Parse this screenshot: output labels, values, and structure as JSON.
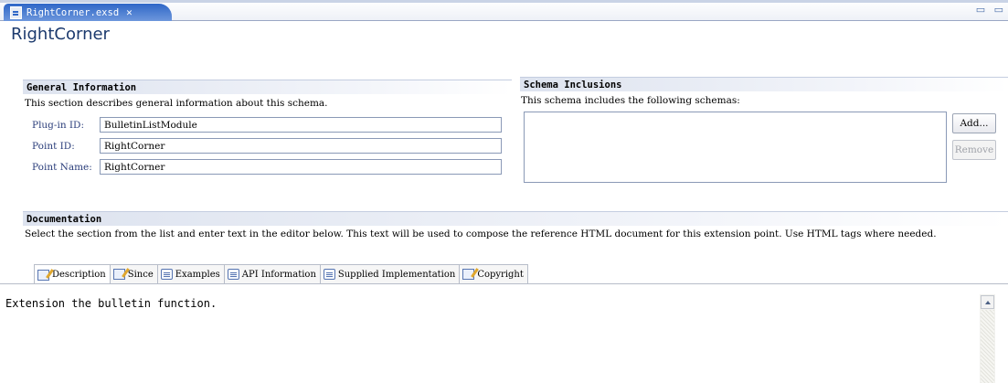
{
  "editor_tab": {
    "title": "RightCorner.exsd",
    "close_glyph": "✕"
  },
  "window_controls": "▭ ▭",
  "page_title": "RightCorner",
  "general": {
    "heading": "General Information",
    "description": "This section describes general information about this schema.",
    "plugin_label": "Plug-in ID:",
    "plugin_value": "BulletinListModule",
    "point_id_label": "Point ID:",
    "point_id_value": "RightCorner",
    "point_name_label": "Point Name:",
    "point_name_value": "RightCorner"
  },
  "inclusions": {
    "heading": "Schema Inclusions",
    "description": "This schema includes the following schemas:",
    "add_label": "Add...",
    "remove_label": "Remove"
  },
  "documentation": {
    "heading": "Documentation",
    "description": "Select the section from the list and enter text in the editor below. This text will be used to compose the reference HTML document for this extension point. Use HTML tags where needed.",
    "tabs": [
      {
        "label": "Description",
        "icon": "edit-icon",
        "active": true
      },
      {
        "label": "Since",
        "icon": "edit-icon",
        "active": false
      },
      {
        "label": "Examples",
        "icon": "page-icon",
        "active": false
      },
      {
        "label": "API Information",
        "icon": "page-icon",
        "active": false
      },
      {
        "label": "Supplied Implementation",
        "icon": "page-icon",
        "active": false
      },
      {
        "label": "Copyright",
        "icon": "edit-icon",
        "active": false
      }
    ],
    "editor_text": "Extension the bulletin function."
  }
}
